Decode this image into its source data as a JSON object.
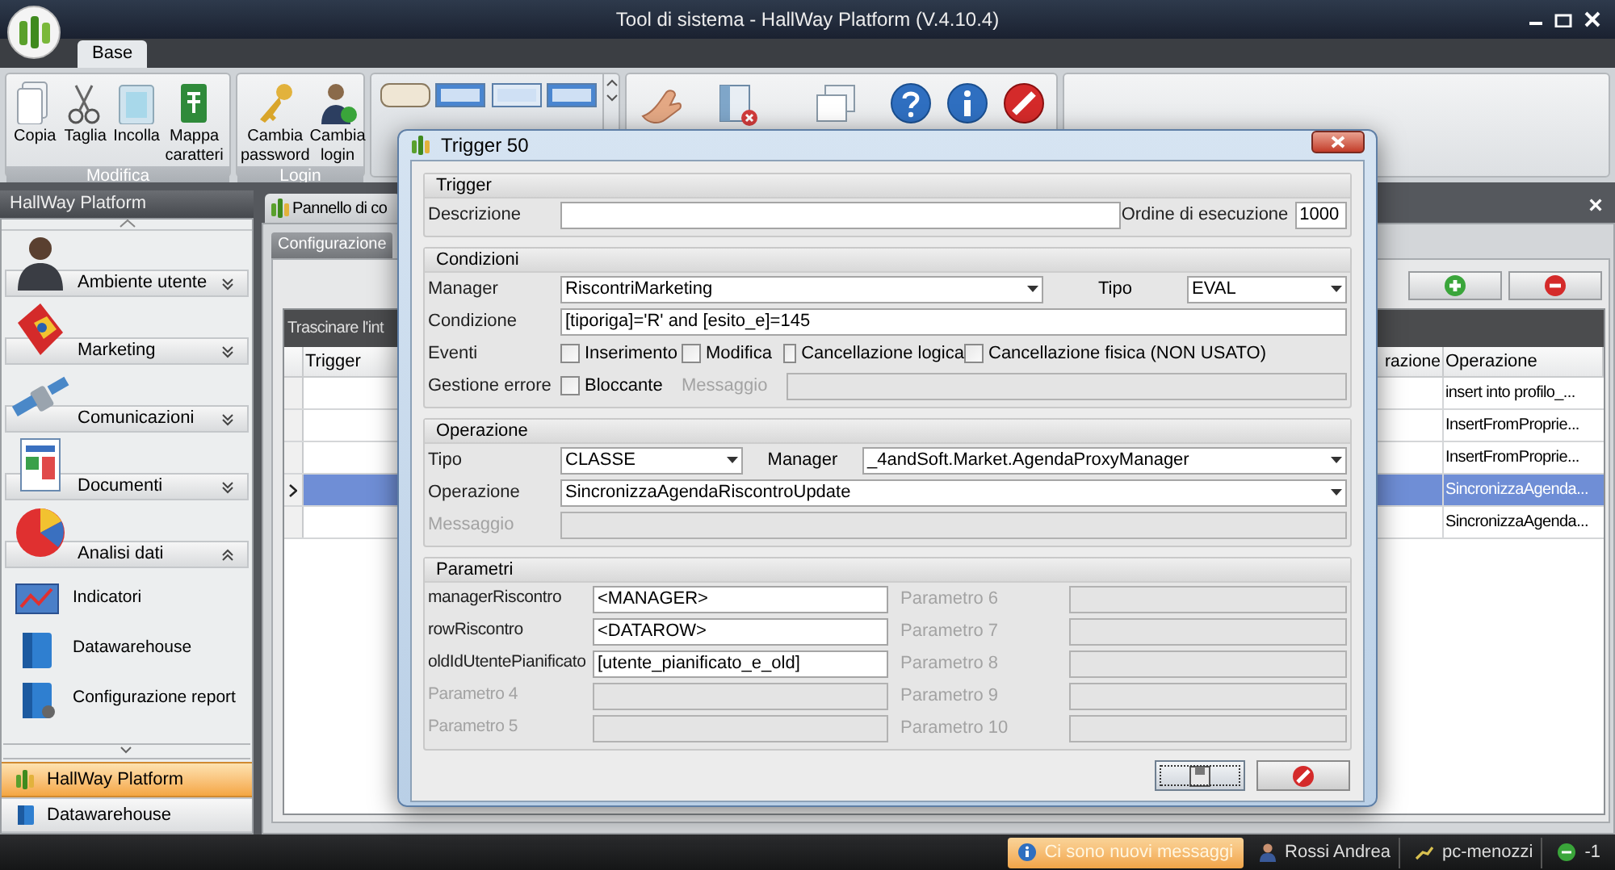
{
  "window": {
    "title": "Tool di sistema - HallWay Platform (V.4.10.4)"
  },
  "ribbon": {
    "tabs": [
      {
        "label": "Base",
        "selected": true
      }
    ],
    "groups": [
      {
        "caption": "Modifica",
        "buttons": [
          {
            "label": "Copia"
          },
          {
            "label": "Taglia"
          },
          {
            "label": "Incolla"
          },
          {
            "label": "Mappa caratteri"
          }
        ]
      },
      {
        "caption": "Login",
        "buttons": [
          {
            "label": "Cambia password"
          },
          {
            "label": "Cambia login"
          }
        ]
      }
    ]
  },
  "sidebar": {
    "title": "HallWay Platform",
    "groups": [
      {
        "label": "Ambiente utente",
        "expanded": false
      },
      {
        "label": "Marketing",
        "expanded": false
      },
      {
        "label": "Comunicazioni",
        "expanded": false
      },
      {
        "label": "Documenti",
        "expanded": false
      },
      {
        "label": "Analisi dati",
        "expanded": true,
        "items": [
          {
            "label": "Indicatori"
          },
          {
            "label": "Datawarehouse"
          },
          {
            "label": "Configurazione report"
          }
        ]
      }
    ],
    "nav_buttons": [
      {
        "label": "HallWay Platform",
        "selected": true
      },
      {
        "label": "Datawarehouse",
        "selected": false
      }
    ]
  },
  "document_tab": {
    "label": "Pannello di co",
    "close": "×"
  },
  "inner_tabs": [
    {
      "label": "Configurazione",
      "selected": true
    }
  ],
  "grid": {
    "group_hint": "Trascinare l'int",
    "columns": [
      {
        "label": "Trigger"
      },
      {
        "label": "razione"
      },
      {
        "label": "Operazione"
      }
    ],
    "rows": [
      {
        "operation": "insert into profilo_...",
        "selected": false
      },
      {
        "operation": "InsertFromProprie...",
        "selected": false
      },
      {
        "operation": "InsertFromProprie...",
        "selected": false
      },
      {
        "operation": "SincronizzaAgenda...",
        "selected": true
      },
      {
        "operation": "SincronizzaAgenda...",
        "selected": false
      }
    ]
  },
  "taskbar": [
    {
      "kind": "notice",
      "label": "Ci sono nuovi messaggi"
    },
    {
      "kind": "user",
      "label": "Rossi Andrea"
    },
    {
      "kind": "computer",
      "label": "pc-menozzi"
    },
    {
      "kind": "status",
      "label": "-1"
    }
  ],
  "dialog": {
    "title": "Trigger 50",
    "trigger_section": {
      "title": "Trigger",
      "description": {
        "label": "Descrizione"
      },
      "order": {
        "label": "Ordine di esecuzione",
        "value": "1000"
      }
    },
    "conditions_section": {
      "title": "Condizioni",
      "manager": {
        "label": "Manager",
        "value": "RiscontriMarketing"
      },
      "type": {
        "label": "Tipo",
        "value": "EVAL"
      },
      "condition": {
        "label": "Condizione",
        "value": "[tiporiga]='R' and [esito_e]=145"
      },
      "events": {
        "label": "Eventi",
        "options": [
          {
            "label": "Inserimento",
            "checked": false
          },
          {
            "label": "Modifica",
            "checked": false
          },
          {
            "label": "Cancellazione logica",
            "checked": false
          },
          {
            "label": "Cancellazione fisica (NON USATO)",
            "checked": false
          }
        ]
      },
      "error_handling": {
        "label": "Gestione errore",
        "blocking": {
          "label": "Bloccante",
          "checked": false
        },
        "message": {
          "label": "Messaggio",
          "disabled": true
        }
      }
    },
    "operation_section": {
      "title": "Operazione",
      "type": {
        "label": "Tipo",
        "value": "CLASSE"
      },
      "manager": {
        "label": "Manager",
        "value": "_4andSoft.Market.AgendaProxyManager"
      },
      "operation": {
        "label": "Operazione",
        "value": "SincronizzaAgendaRiscontroUpdate"
      },
      "message": {
        "label": "Messaggio",
        "disabled": true
      }
    },
    "parameters_section": {
      "title": "Parametri",
      "parameters": [
        {
          "label": "managerRiscontro",
          "value": "<MANAGER>",
          "disabled": false
        },
        {
          "label": "rowRiscontro",
          "value": "<DATAROW>",
          "disabled": false
        },
        {
          "label": "oldIdUtentePianificato",
          "value": "[utente_pianificato_e_old]",
          "disabled": false
        },
        {
          "label": "Parametro 4",
          "disabled": true
        },
        {
          "label": "Parametro 5",
          "disabled": true
        },
        {
          "label": "Parametro 6",
          "disabled": true
        },
        {
          "label": "Parametro 7",
          "disabled": true
        },
        {
          "label": "Parametro 8",
          "disabled": true
        },
        {
          "label": "Parametro 9",
          "disabled": true
        },
        {
          "label": "Parametro 10",
          "disabled": true
        }
      ]
    }
  }
}
